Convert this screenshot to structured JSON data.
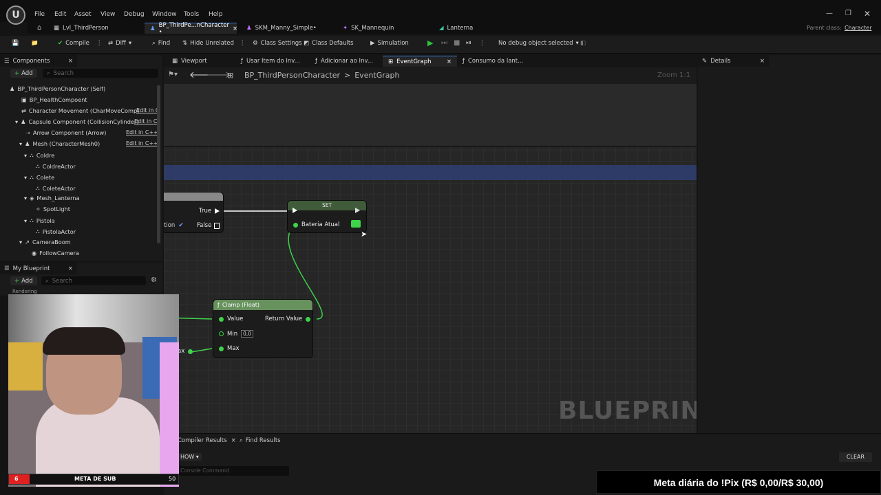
{
  "menu": [
    "File",
    "Edit",
    "Asset",
    "View",
    "Debug",
    "Window",
    "Tools",
    "Help"
  ],
  "tabs": [
    {
      "label": "Lvl_ThirdPerson"
    },
    {
      "label": "BP_ThirdPe...nCharacter •",
      "close": "×"
    },
    {
      "label": "SKM_Manny_Simple•"
    },
    {
      "label": "SK_Mannequin"
    },
    {
      "label": "Lanterna"
    }
  ],
  "parent_class": {
    "label": "Parent class:",
    "value": "Character"
  },
  "toolbar": {
    "compile": "Compile",
    "diff": "Diff",
    "find": "Find",
    "hide_unrelated": "Hide Unrelated",
    "class_settings": "Class Settings",
    "class_defaults": "Class Defaults",
    "simulation": "Simulation",
    "debug_object": "No debug object selected"
  },
  "components": {
    "title": "Components",
    "add": "Add",
    "search_placeholder": "Search",
    "root": "BP_ThirdPersonCharacter (Self)",
    "items": [
      {
        "label": "BP_HealthCompoent"
      },
      {
        "label": "Character Movement (CharMoveComp)",
        "edit": "Edit in C"
      },
      {
        "label": "Capsule Component (CollisionCylinder)",
        "edit": "Edit in C"
      },
      {
        "label": "Arrow Component (Arrow)",
        "edit": "Edit in C++"
      },
      {
        "label": "Mesh (CharacterMesh0)",
        "edit": "Edit in C++"
      },
      {
        "label": "Coldre"
      },
      {
        "label": "ColdreActor"
      },
      {
        "label": "Colete"
      },
      {
        "label": "ColeteActor"
      },
      {
        "label": "Mesh_Lanterna"
      },
      {
        "label": "SpotLight"
      },
      {
        "label": "Pistola"
      },
      {
        "label": "PistolaActor"
      },
      {
        "label": "CameraBoom"
      },
      {
        "label": "FollowCamera"
      }
    ]
  },
  "my_blueprint": {
    "title": "My Blueprint",
    "add": "Add",
    "search_placeholder": "Search",
    "section": "Rendering"
  },
  "doc_tabs": [
    {
      "label": "Viewport"
    },
    {
      "label": "Usar Item do Inv..."
    },
    {
      "label": "Adicionar ao Inv..."
    },
    {
      "label": "EventGraph",
      "close": "×"
    },
    {
      "label": "Consumo da lant..."
    }
  ],
  "details": {
    "title": "Details",
    "close": "×"
  },
  "breadcrumb": {
    "root": "BP_ThirdPersonCharacter",
    "sep": ">",
    "current": "EventGraph",
    "zoom": "Zoom 1:1"
  },
  "graph": {
    "branch": {
      "true_label": "True",
      "false_label": "False",
      "partial": "tion"
    },
    "set_node": {
      "title": "SET",
      "pin": "Bateria Atual"
    },
    "clamp": {
      "title": "Clamp (Float)",
      "value": "Value",
      "return": "Return Value",
      "min": "Min",
      "min_value": "0,0",
      "max": "Max",
      "partial_max": "ax"
    },
    "watermark": "BLUEPRINT"
  },
  "bottom": {
    "compiler_results": "Compiler Results",
    "find_results": "Find Results",
    "show": "HOW",
    "console_placeholder": "Console Command",
    "clear": "CLEAR"
  },
  "overlay": {
    "meta_count": "6",
    "meta_label": "META DE SUB",
    "meta_target": "50",
    "pix_text": "Meta diária do !Pix (R$ 0,00/R$ 30,00)",
    "meta_progress": 0.12
  },
  "colors": {
    "accent_blue": "#3a7bd5",
    "pin_green": "#3ed34a",
    "play_green": "#2fc23d",
    "meta_red": "#e02020"
  }
}
